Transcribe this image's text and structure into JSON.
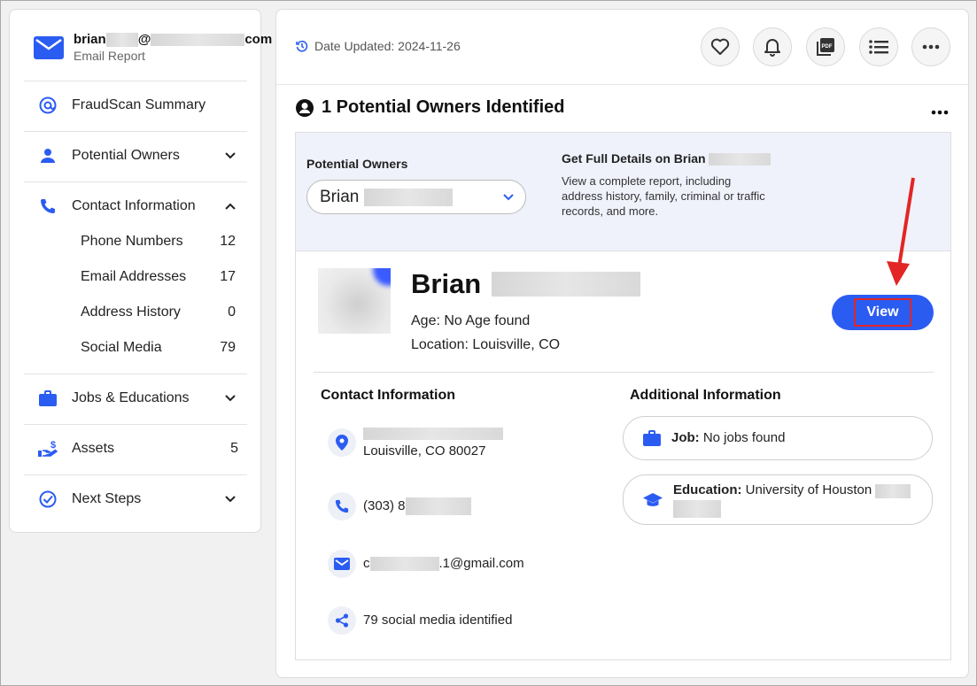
{
  "sidebar": {
    "email_prefix": "brian",
    "email_at": "@",
    "email_suffix": "com",
    "email_sub": "Email Report",
    "items": [
      {
        "label": "FraudScan Summary"
      },
      {
        "label": "Potential Owners"
      },
      {
        "label": "Contact Information"
      },
      {
        "label": "Jobs & Educations"
      },
      {
        "label": "Assets",
        "count": "5"
      },
      {
        "label": "Next Steps"
      }
    ],
    "contact_sub": [
      {
        "label": "Phone Numbers",
        "count": "12"
      },
      {
        "label": "Email Addresses",
        "count": "17"
      },
      {
        "label": "Address History",
        "count": "0"
      },
      {
        "label": "Social Media",
        "count": "79"
      }
    ]
  },
  "header": {
    "date_updated": "Date Updated: 2024-11-26",
    "icons": [
      "heart-icon",
      "bell-icon",
      "pdf-icon",
      "list-icon",
      "more-icon"
    ]
  },
  "section": {
    "title": "1 Potential Owners Identified"
  },
  "owners": {
    "label": "Potential Owners",
    "selected": "Brian",
    "full_details_title": "Get Full Details on Brian",
    "full_details_text": "View a complete report, including address history, family, criminal or traffic records, and more."
  },
  "person": {
    "name": "Brian",
    "age": "Age: No Age found",
    "location": "Location: Louisville, CO",
    "view_label": "View"
  },
  "contact": {
    "title": "Contact Information",
    "address": "Louisville, CO 80027",
    "phone": "(303) 8",
    "email_start": "c",
    "email_end": ".1@gmail.com",
    "social": "79 social media identified"
  },
  "additional": {
    "title": "Additional Information",
    "job_label": "Job:",
    "job_value": "No jobs found",
    "edu_label": "Education:",
    "edu_value": "University of Houston"
  },
  "colors": {
    "accent": "#2b5cf2",
    "highlight": "#e22525"
  }
}
